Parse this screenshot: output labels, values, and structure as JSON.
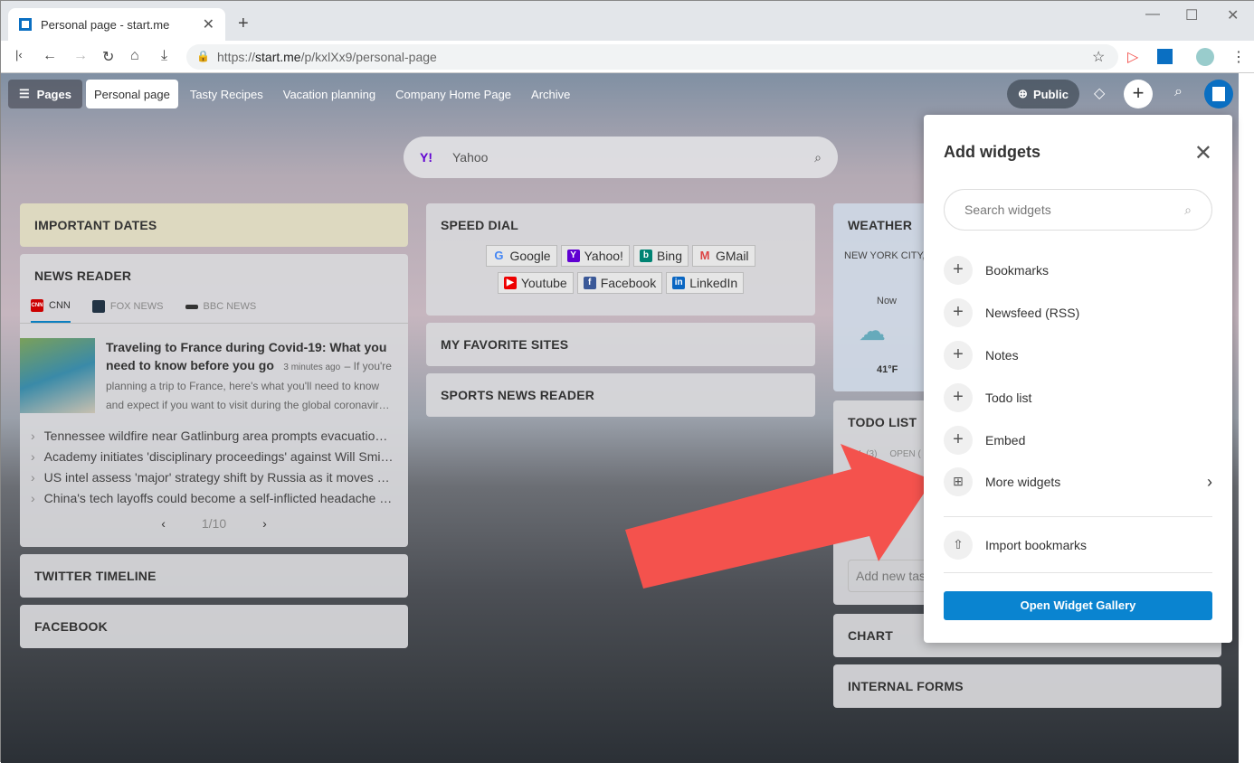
{
  "browser": {
    "tab_title": "Personal page - start.me",
    "url_prefix": "https://",
    "url_host": "start.me",
    "url_path": "/p/kxlXx9/personal-page"
  },
  "nav": {
    "pages_label": "Pages",
    "tabs": [
      "Personal page",
      "Tasty Recipes",
      "Vacation planning",
      "Company Home Page",
      "Archive"
    ],
    "public_label": "Public"
  },
  "search": {
    "engine": "Yahoo"
  },
  "widgets": {
    "important_dates": "IMPORTANT DATES",
    "news_reader": {
      "title": "NEWS READER",
      "tabs": [
        "CNN",
        "FOX NEWS",
        "BBC NEWS"
      ],
      "featured": {
        "title": "Traveling to France during Covid-19: What you need to know before you go",
        "time": "3 minutes ago",
        "desc": "If you're planning a trip to France, here's what you'll need to know and expect if you want to visit during the global coronavir…"
      },
      "items": [
        "Tennessee wildfire near Gatlinburg area prompts evacuatio…",
        "Academy initiates 'disciplinary proceedings' against Will Smi…",
        "US intel assess 'major' strategy shift by Russia as it moves …",
        "China's tech layoffs could become a self-inflicted headache …"
      ],
      "pager": "1/10"
    },
    "twitter": "TWITTER TIMELINE",
    "facebook": "FACEBOOK",
    "speed_dial": {
      "title": "SPEED DIAL",
      "links": [
        "Google",
        "Yahoo!",
        "Bing",
        "GMail",
        "Youtube",
        "Facebook",
        "LinkedIn"
      ]
    },
    "favorites": "MY FAVORITE SITES",
    "sports": "SPORTS NEWS READER",
    "weather": {
      "title": "WEATHER",
      "location": "NEW YORK CITY,",
      "now": "Now",
      "temp": "41°F"
    },
    "todo": {
      "title": "TODO LIST",
      "tabs": [
        "ALL (3)",
        "OPEN ("
      ],
      "input_placeholder": "Add new tas"
    },
    "chart": "CHART",
    "forms": "INTERNAL FORMS"
  },
  "add_widgets": {
    "title": "Add widgets",
    "search_placeholder": "Search widgets",
    "items": [
      "Bookmarks",
      "Newsfeed (RSS)",
      "Notes",
      "Todo list",
      "Embed"
    ],
    "more": "More widgets",
    "import": "Import bookmarks",
    "gallery_button": "Open Widget Gallery"
  },
  "colors": {
    "accent": "#0a84d0",
    "arrow": "#f4524d",
    "important_dates_bg": "#dedbc0"
  }
}
